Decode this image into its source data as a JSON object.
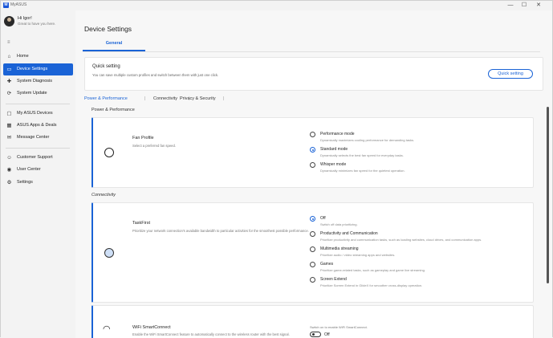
{
  "app": {
    "title": "MyASUS",
    "logo_text": "M"
  },
  "window_controls": {
    "minimize": "—",
    "maximize": "☐",
    "close": "✕"
  },
  "user": {
    "greeting": "Hi Igor!",
    "subtitle": "Great to have you here."
  },
  "sidebar": {
    "collapse_icon": "≡",
    "items": [
      {
        "label": "Home",
        "icon": "⌂"
      },
      {
        "label": "Device Settings",
        "icon": "▭"
      },
      {
        "label": "System Diagnosis",
        "icon": "✚"
      },
      {
        "label": "System Update",
        "icon": "⟳"
      },
      {
        "label": "My ASUS Devices",
        "icon": "▢"
      },
      {
        "label": "ASUS Apps & Deals",
        "icon": "▦"
      },
      {
        "label": "Message Center",
        "icon": "✉"
      },
      {
        "label": "Customer Support",
        "icon": "☺"
      },
      {
        "label": "User Center",
        "icon": "◉"
      },
      {
        "label": "Settings",
        "icon": "⚙"
      }
    ]
  },
  "page": {
    "title": "Device Settings",
    "tab": "General"
  },
  "quick_setting": {
    "title": "Quick setting",
    "description": "You can save multiple custom profiles and switch between them with just one click.",
    "button": "Quick setting"
  },
  "subnav": [
    "Power & Performance",
    "Connectivity",
    "Privacy & Security"
  ],
  "subnav_sep": "|",
  "sections": {
    "power": "Power & Performance",
    "connectivity": "Connectivity"
  },
  "fan_profile": {
    "title": "Fan Profile",
    "description": "Select a preferred fan speed.",
    "options": [
      {
        "label": "Performance mode",
        "desc": "Dynamically maximizes cooling performance for demanding tasks."
      },
      {
        "label": "Standard mode",
        "desc": "Dynamically selects the best fan speed for everyday tasks."
      },
      {
        "label": "Whisper mode",
        "desc": "Dynamically minimizes fan speed for the quietest operation."
      }
    ],
    "selected": 1
  },
  "taskfirst": {
    "title": "TaskFirst",
    "description": "Prioritize your network connection's available bandwidth to particular activities for the smoothest possible performance.",
    "options": [
      {
        "label": "Off",
        "desc": "Switch off data prioritizing."
      },
      {
        "label": "Productivity and Communication",
        "desc": "Prioritize productivity and communication tasks, such as loading websites, cloud drives, and communication apps."
      },
      {
        "label": "Multimedia streaming",
        "desc": "Prioritize audio / video streaming apps and websites."
      },
      {
        "label": "Games",
        "desc": "Prioritize game-related tasks, such as gameplay and game live streaming."
      },
      {
        "label": "Screen Extend",
        "desc": "Prioritize Screen Extend in GlideX for smoother cross-display operation."
      }
    ],
    "selected": 0
  },
  "wifi": {
    "title": "WiFi SmartConnect",
    "description": "Enable the WiFi SmartConnect feature to automatically connect to the wireless router with the best signal.",
    "toggle_hint": "Switch on to enable WiFi SmartConnect.",
    "toggle_state": "Off"
  },
  "colors": {
    "accent": "#1a63d6"
  }
}
